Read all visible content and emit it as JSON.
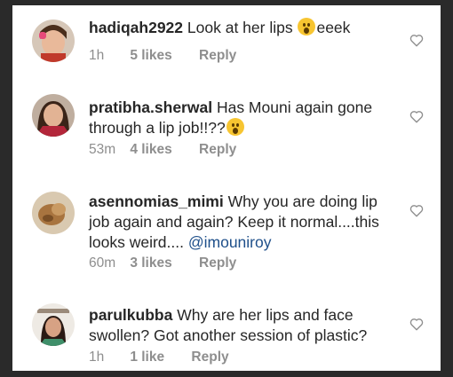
{
  "comments": [
    {
      "username": "hadiqah2922",
      "text_before": "Look at her lips",
      "emoji": "astonished-face-emoji",
      "text_after": "eeek",
      "time": "1h",
      "likes": "5 likes",
      "reply": "Reply"
    },
    {
      "username": "pratibha.sherwal",
      "text_before": "Has Mouni again gone through a lip job!!??",
      "emoji": "astonished-face-emoji",
      "time": "53m",
      "likes": "4 likes",
      "reply": "Reply"
    },
    {
      "username": "asennomias_mimi",
      "text_before": "Why you are doing lip job again and again?  Keep it normal....this looks weird....",
      "mention": "@imouniroy",
      "time": "60m",
      "likes": "3 likes",
      "reply": "Reply"
    },
    {
      "username": "parulkubba",
      "text_before": "Why are her lips and face swollen? Got another session of plastic?",
      "time": "1h",
      "likes": "1 like",
      "reply": "Reply"
    }
  ],
  "colors": {
    "text": "#262626",
    "meta": "#8e8e8e",
    "mention": "#1e4f8a",
    "background_outer": "#2a2a2a"
  },
  "icons": {
    "like": "heart-outline-icon"
  }
}
